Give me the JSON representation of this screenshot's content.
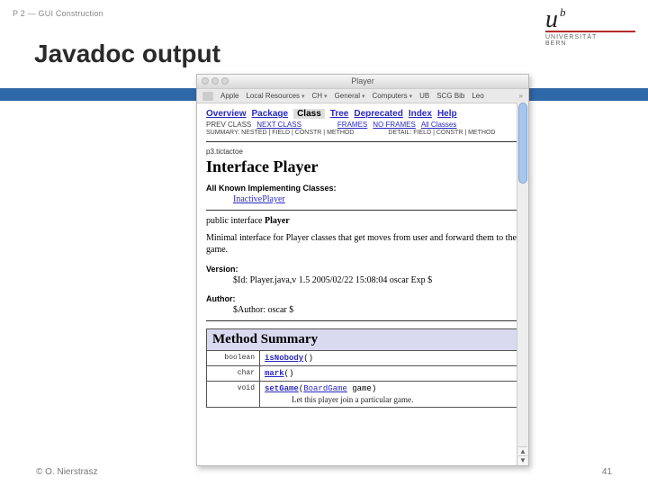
{
  "header": {
    "label": "P 2 — GUI Construction"
  },
  "title": "Javadoc output",
  "logo": {
    "u": "u",
    "b": "b",
    "line1": "UNIVERSITÄT",
    "line2": "BERN"
  },
  "footer": {
    "copyright": "© O. Nierstrasz",
    "page": "41"
  },
  "browser": {
    "windowTitle": "Player",
    "toolbar": {
      "items": [
        {
          "label": "Apple",
          "drop": false
        },
        {
          "label": "Local Resources",
          "drop": true
        },
        {
          "label": "CH",
          "drop": true
        },
        {
          "label": "General",
          "drop": true
        },
        {
          "label": "Computers",
          "drop": true
        },
        {
          "label": "UB",
          "drop": false
        },
        {
          "label": "SCG Bib",
          "drop": false
        },
        {
          "label": "Leo",
          "drop": false
        }
      ]
    },
    "nav": {
      "main": [
        "Overview",
        "Package",
        "Class",
        "Tree",
        "Deprecated",
        "Index",
        "Help"
      ],
      "selectedIndex": 2,
      "sub": {
        "leftPlain": "PREV CLASS",
        "leftLink": "NEXT CLASS",
        "rightLinks": [
          "FRAMES",
          "NO FRAMES",
          "All Classes"
        ]
      },
      "summary": {
        "left": "SUMMARY: NESTED | FIELD | CONSTR | METHOD",
        "right": "DETAIL: FIELD | CONSTR | METHOD"
      }
    },
    "package": "p3.tictactoe",
    "interfaceTitle": "Interface Player",
    "impl": {
      "label": "All Known Implementing Classes:",
      "value": "InactivePlayer"
    },
    "signature": {
      "prefix": "public interface ",
      "name": "Player"
    },
    "description": "Minimal interface for Player classes that get moves from user and forward them to the game.",
    "version": {
      "label": "Version:",
      "value": "$Id: Player.java,v 1.5 2005/02/22 15:08:04 oscar Exp $"
    },
    "author": {
      "label": "Author:",
      "value": "$Author: oscar $"
    },
    "methodSummary": {
      "heading": "Method Summary",
      "rows": [
        {
          "ret": "boolean",
          "name": "isNobody",
          "args": "()",
          "desc": ""
        },
        {
          "ret": "char",
          "name": "mark",
          "args": "()",
          "desc": ""
        },
        {
          "ret": "void",
          "name": "setGame",
          "argsPre": "(",
          "argType": "BoardGame",
          "argRest": " game)",
          "desc": "Let this player join a particular game."
        }
      ]
    }
  }
}
